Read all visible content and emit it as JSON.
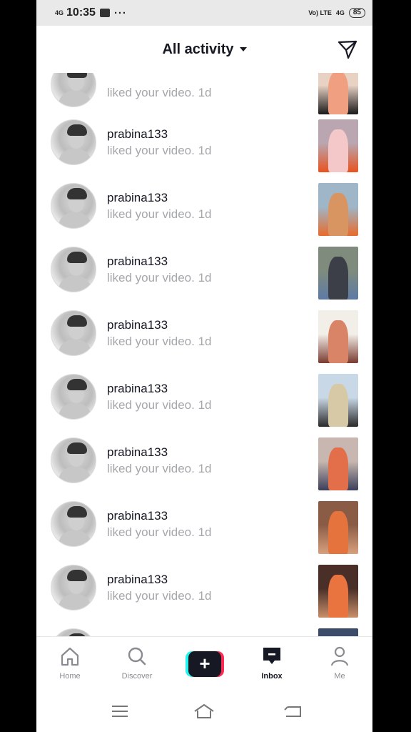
{
  "status_bar": {
    "network": "4G",
    "time": "10:35",
    "more": "···",
    "carrier": "Vo) LTE",
    "network_right": "4G",
    "battery": "85"
  },
  "header": {
    "title": "All activity",
    "send_icon": "send-icon",
    "dropdown_icon": "caret-down-icon"
  },
  "activities": [
    {
      "username": "",
      "action": "liked your video. 1d",
      "thumb_colors": [
        "#e8d2c4",
        "#f0a080",
        "#1a1a1a"
      ]
    },
    {
      "username": "prabina133",
      "action": "liked your video. 1d",
      "thumb_colors": [
        "#b9a6b0",
        "#f4c7c8",
        "#e8531f"
      ]
    },
    {
      "username": "prabina133",
      "action": "liked your video. 1d",
      "thumb_colors": [
        "#9fb6c8",
        "#d99561",
        "#e86b2b"
      ]
    },
    {
      "username": "prabina133",
      "action": "liked your video. 1d",
      "thumb_colors": [
        "#7f8c7d",
        "#3c3f48",
        "#5d7aa5"
      ]
    },
    {
      "username": "prabina133",
      "action": "liked your video. 1d",
      "thumb_colors": [
        "#f2efe9",
        "#d98466",
        "#7a3b30"
      ]
    },
    {
      "username": "prabina133",
      "action": "liked your video. 1d",
      "thumb_colors": [
        "#c9d8e6",
        "#d8c9a6",
        "#2a2a2a"
      ]
    },
    {
      "username": "prabina133",
      "action": "liked your video. 1d",
      "thumb_colors": [
        "#c7b7b0",
        "#e36f4a",
        "#3b3e5a"
      ]
    },
    {
      "username": "prabina133",
      "action": "liked your video. 1d",
      "thumb_colors": [
        "#8a5c46",
        "#e5733d",
        "#d8a07d"
      ]
    },
    {
      "username": "prabina133",
      "action": "liked your video. 1d",
      "thumb_colors": [
        "#4a2f28",
        "#ea7440",
        "#c98f6a"
      ]
    },
    {
      "username": "",
      "action": "",
      "thumb_colors": [
        "#3a4c6a",
        "#c58a6a",
        "#2a2a2a"
      ]
    }
  ],
  "bottom_nav": {
    "home": {
      "label": "Home",
      "icon": "home-icon"
    },
    "discover": {
      "label": "Discover",
      "icon": "search-icon"
    },
    "create": {
      "label": "+",
      "icon": "plus-icon"
    },
    "inbox": {
      "label": "Inbox",
      "icon": "inbox-icon"
    },
    "me": {
      "label": "Me",
      "icon": "person-icon"
    }
  },
  "system_nav": {
    "menu": "menu-icon",
    "home": "home-outline-icon",
    "back": "back-icon"
  },
  "colors": {
    "text_primary": "#161823",
    "text_secondary": "#a5a7ab",
    "accent_cyan": "#25f4ee",
    "accent_red": "#fe2c55"
  }
}
